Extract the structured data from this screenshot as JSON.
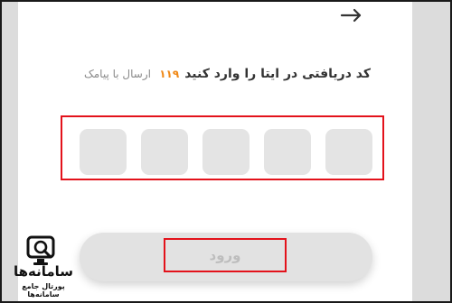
{
  "header": {
    "back_icon": "arrow-right-icon"
  },
  "verification": {
    "prompt": "کد دریافتی در ایتا را وارد کنید",
    "countdown": "۱۱۹",
    "resend_label": "ارسال با پیامک",
    "code_length": 5,
    "code_values": [
      "",
      "",
      "",
      "",
      ""
    ]
  },
  "actions": {
    "login_label": "ورود"
  },
  "watermark": {
    "name": "سامانه‌ها",
    "tagline": "پورتال جامع سامانه‌ها",
    "icon": "search-monitor-icon"
  },
  "colors": {
    "accent": "#f08a1a",
    "highlight_outline": "#e3121b",
    "input_fill": "#e4e4e4",
    "button_fill": "#e2e2e2"
  }
}
